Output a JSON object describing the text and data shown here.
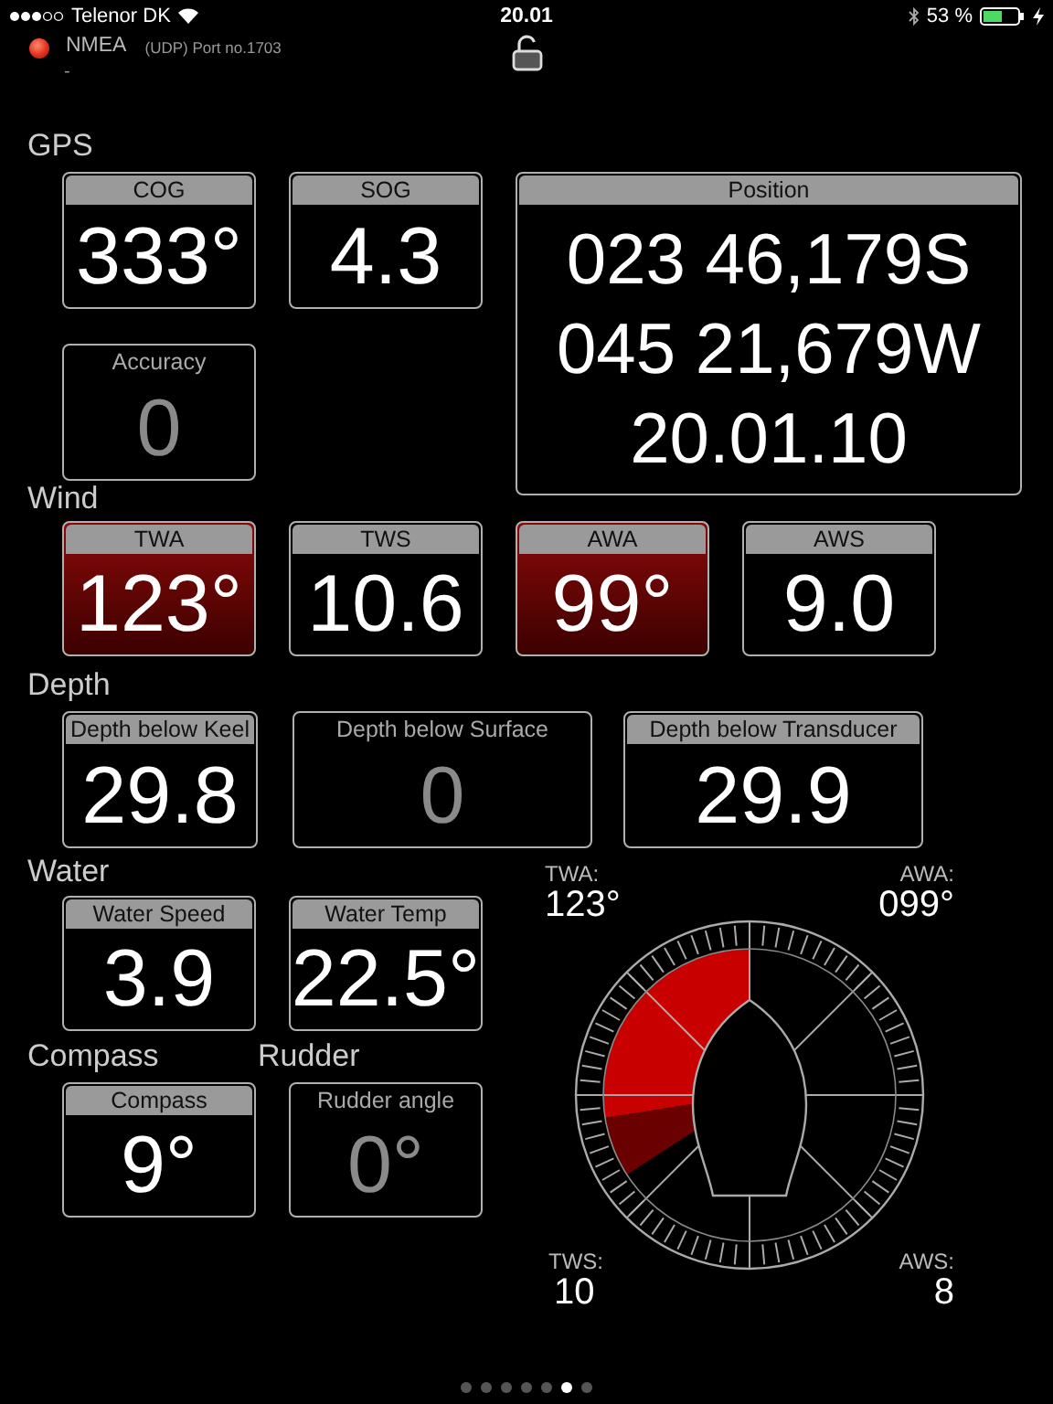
{
  "status_bar": {
    "carrier": "Telenor DK",
    "time": "20.01",
    "battery": "53 %"
  },
  "connection": {
    "connected": false,
    "name": "NMEA",
    "detail": "(UDP) Port no.1703",
    "info": "-"
  },
  "gps": {
    "title": "GPS",
    "tiles": [
      {
        "label": "COG",
        "value": "333°",
        "active": true,
        "alarm": false
      },
      {
        "label": "SOG",
        "value": "4.3",
        "active": true,
        "alarm": false
      },
      {
        "label": "Accuracy",
        "value": "0",
        "active": false,
        "alarm": false
      }
    ],
    "position": {
      "label": "Position",
      "lines": [
        "023 46,179S",
        "045 21,679W",
        "20.01.10"
      ],
      "active": true,
      "alarm": false
    }
  },
  "wind": {
    "title": "Wind",
    "tiles": [
      {
        "label": "TWA",
        "value": "123°",
        "active": true,
        "alarm": true
      },
      {
        "label": "TWS",
        "value": "10.6",
        "active": true,
        "alarm": false
      },
      {
        "label": "AWA",
        "value": "99°",
        "active": true,
        "alarm": true
      },
      {
        "label": "AWS",
        "value": "9.0",
        "active": true,
        "alarm": false
      }
    ]
  },
  "depth": {
    "title": "Depth",
    "tiles": [
      {
        "label": "Depth below Keel",
        "value": "29.8",
        "active": true,
        "alarm": false
      },
      {
        "label": "Depth below Surface",
        "value": "0",
        "active": false,
        "alarm": false
      },
      {
        "label": "Depth below Transducer",
        "value": "29.9",
        "active": true,
        "alarm": false
      }
    ]
  },
  "water": {
    "title": "Water",
    "tiles": [
      {
        "label": "Water Speed",
        "value": "3.9",
        "active": true,
        "alarm": false
      },
      {
        "label": "Water Temp",
        "value": "22.5°",
        "active": true,
        "alarm": false
      }
    ]
  },
  "compass": {
    "title": "Compass",
    "tiles": [
      {
        "label": "Compass",
        "value": "9°",
        "active": true,
        "alarm": false
      }
    ]
  },
  "rudder": {
    "title": "Rudder",
    "tiles": [
      {
        "label": "Rudder angle",
        "value": "0°",
        "active": false,
        "alarm": false
      }
    ]
  },
  "wind_dial": {
    "twa_label": "TWA:",
    "twa": "123°",
    "awa_label": "AWA:",
    "awa": "099°",
    "tws_label": "TWS:",
    "tws": "10",
    "aws_label": "AWS:",
    "aws": "8"
  },
  "pages": [
    {
      "selected": false
    },
    {
      "selected": false
    },
    {
      "selected": false
    },
    {
      "selected": false
    },
    {
      "selected": false
    },
    {
      "selected": true
    },
    {
      "selected": false
    }
  ]
}
